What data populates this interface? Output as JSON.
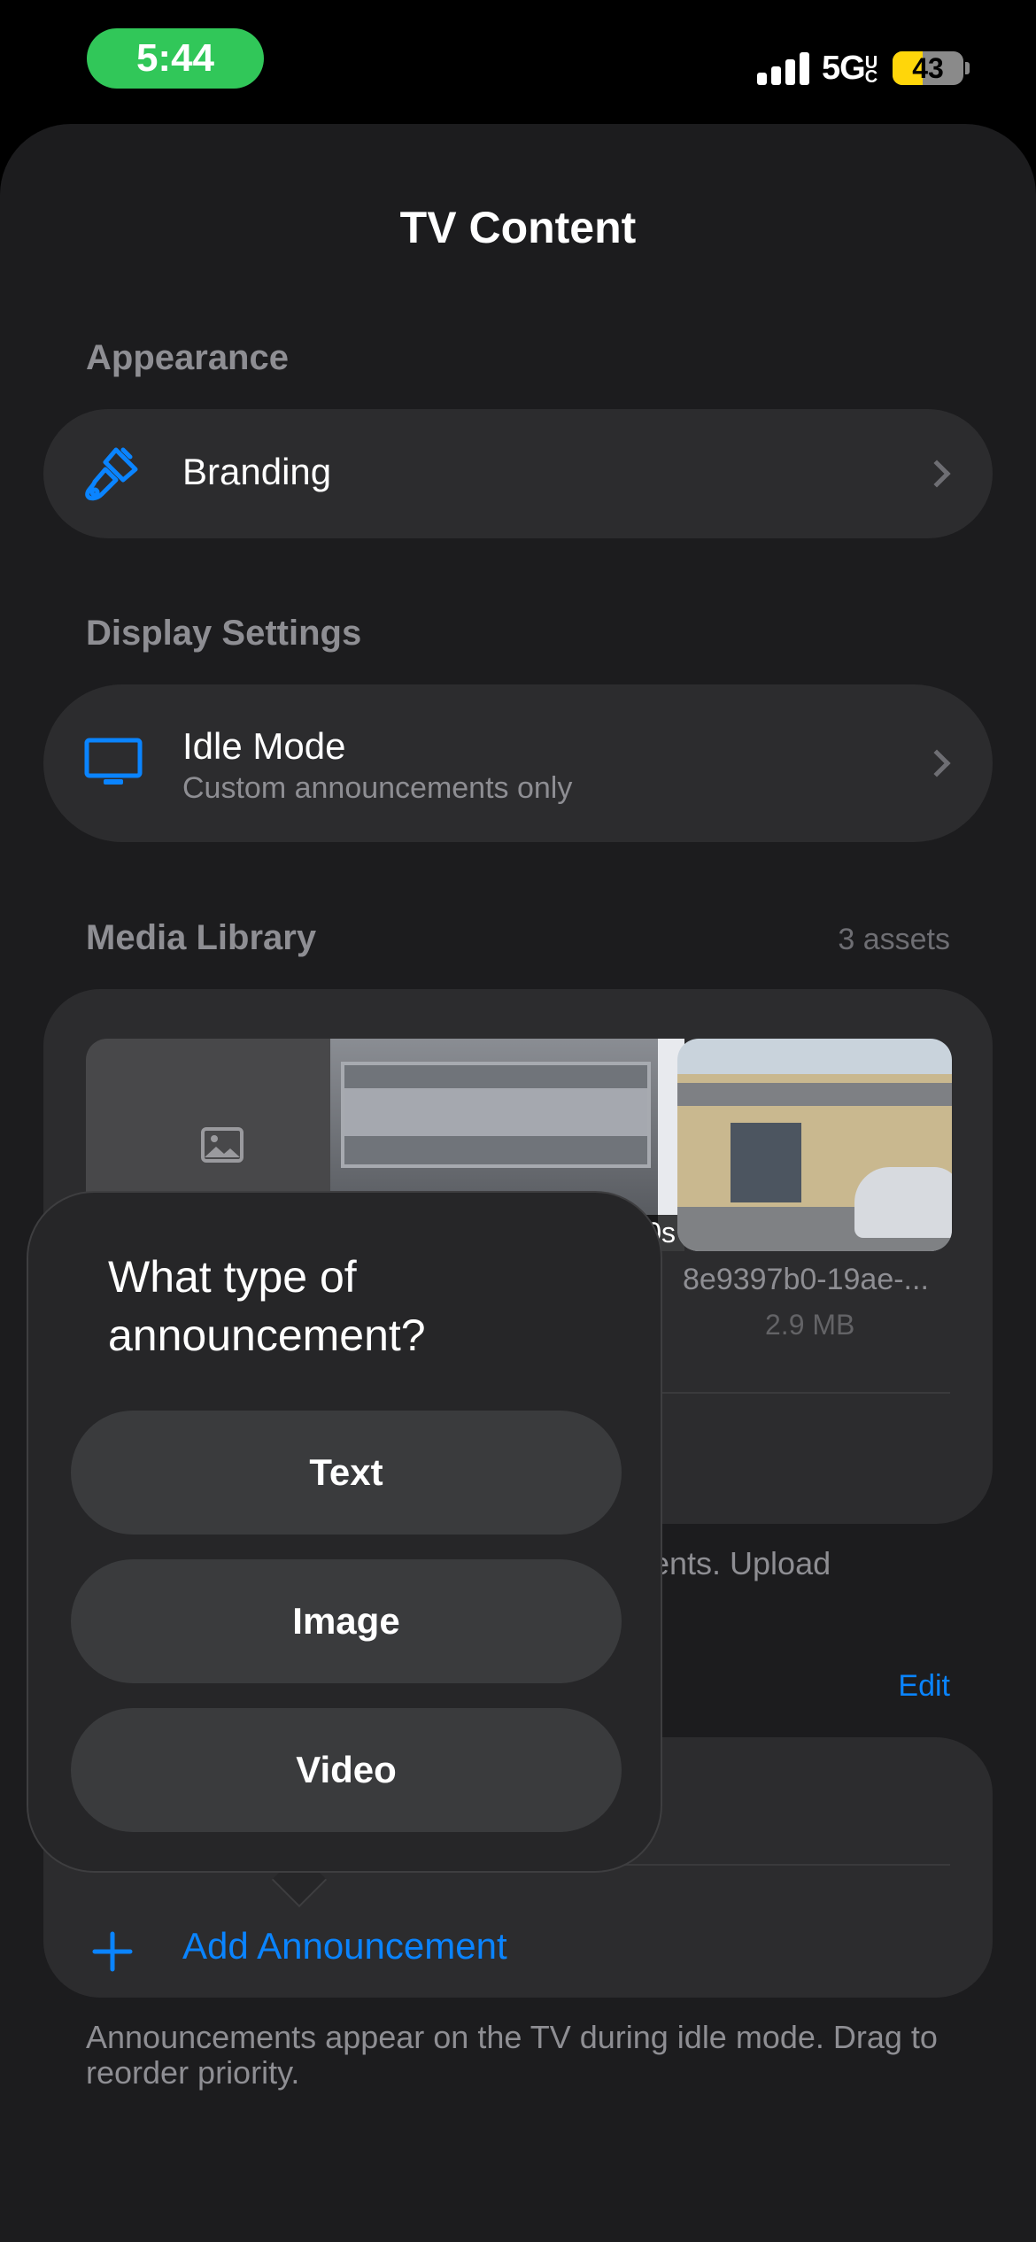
{
  "status_bar": {
    "time": "5:44",
    "network": "5G",
    "network_suffix": "UC",
    "battery_level": "43",
    "battery_fraction": 0.43,
    "colors": {
      "time_pill": "#31c759",
      "battery": "#ffd60a"
    }
  },
  "page": {
    "title": "TV Content"
  },
  "appearance": {
    "header": "Appearance",
    "branding": {
      "label": "Branding",
      "icon": "paintbrush-icon"
    }
  },
  "display_settings": {
    "header": "Display Settings",
    "idle_mode": {
      "label": "Idle Mode",
      "subtitle": "Custom announcements only",
      "icon": "tv-icon"
    }
  },
  "media_library": {
    "header": "Media Library",
    "count": "3 assets",
    "assets": [
      {
        "kind": "image-placeholder"
      },
      {
        "kind": "video",
        "duration": "10s"
      },
      {
        "kind": "photo",
        "name": "8e9397b0-19ae-...",
        "size": "2.9 MB"
      }
    ],
    "footnote_partial": "ments. Upload"
  },
  "announcements": {
    "edit": "Edit",
    "add_label": "Add Announcement",
    "footnote": "Announcements appear on the TV during idle mode. Drag to reorder priority."
  },
  "popover": {
    "title": "What type of announcement?",
    "options": [
      "Text",
      "Image",
      "Video"
    ]
  },
  "accent_color": "#0a84ff"
}
